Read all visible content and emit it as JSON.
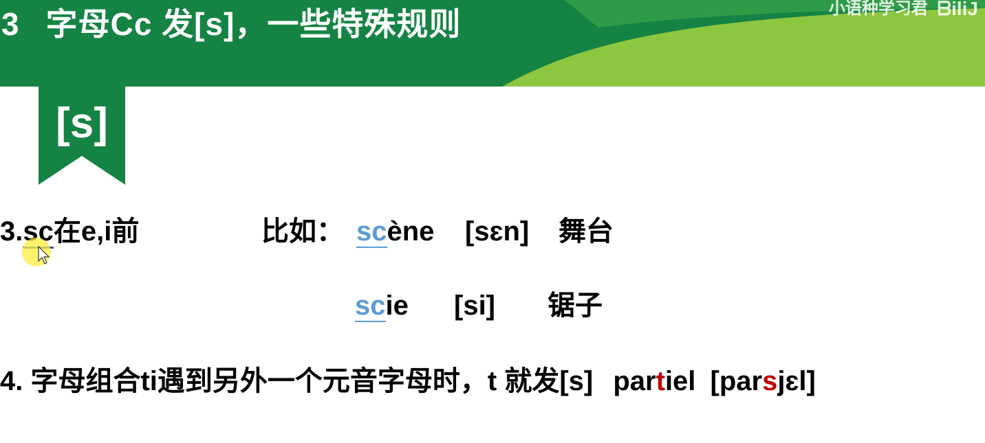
{
  "header": {
    "number": "3",
    "title": "字母Cc 发[s]，一些特殊规则",
    "watermark": "小语种学习君",
    "logo_text": "bili"
  },
  "ribbon": {
    "label": "[s]"
  },
  "rule3": {
    "prefix": "3.",
    "sc": "sc",
    "condition": "在e,i前",
    "example_label": "比如：",
    "ex1_hl": "sc",
    "ex1_rest": "ène",
    "ex1_ipa": "[sɛn]",
    "ex1_meaning": "舞台",
    "ex2_hl": "sc",
    "ex2_rest": "ie",
    "ex2_ipa": "[si]",
    "ex2_meaning": "锯子"
  },
  "rule4": {
    "text": "4. 字母组合ti遇到另外一个元音字母时，t 就发[s]",
    "word_a": "par",
    "word_t": "t",
    "word_b": "iel",
    "ipa_a": "[par",
    "ipa_s": "s",
    "ipa_b": "jɛl]"
  },
  "colors": {
    "green_dark": "#148344",
    "green_light": "#8dc63f",
    "highlight_blue": "#5b9bd5",
    "red": "#c00000"
  }
}
